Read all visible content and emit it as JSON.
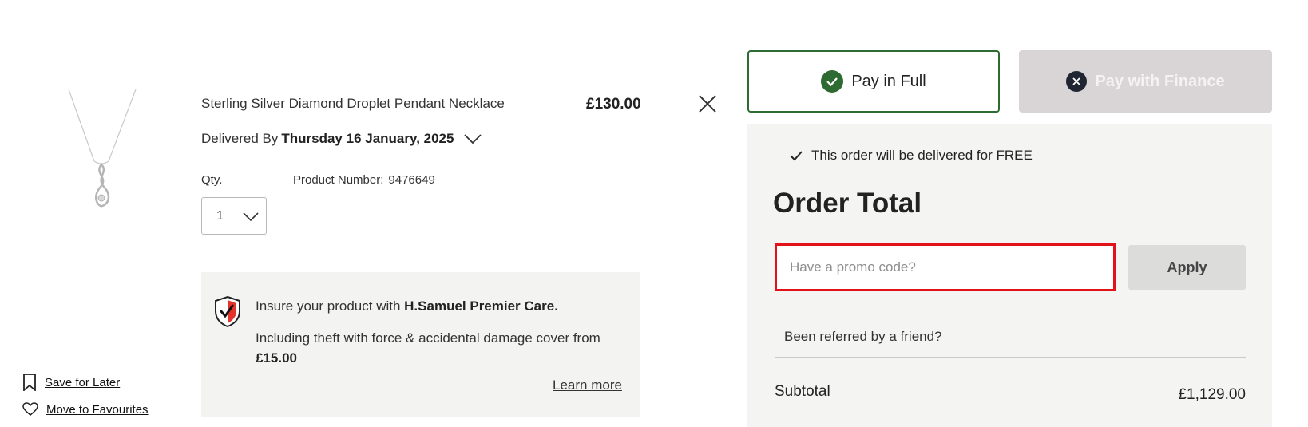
{
  "product": {
    "title": "Sterling Silver Diamond Droplet Pendant Necklace",
    "price": "£130.00",
    "delivery_prefix": "Delivered By",
    "delivery_date": "Thursday 16 January, 2025",
    "qty_label": "Qty.",
    "qty_value": "1",
    "product_number_label": "Product Number:",
    "product_number": "9476649"
  },
  "insurance": {
    "title_prefix": "Insure your product with",
    "title_brand": "H.Samuel Premier Care.",
    "desc_prefix": "Including theft with force & accidental damage cover from",
    "desc_price": "£15.00",
    "learn_more": "Learn more"
  },
  "item_actions": {
    "save_for_later": "Save for Later",
    "move_to_favourites": "Move to Favourites"
  },
  "payment": {
    "pay_in_full": "Pay in Full",
    "pay_with_finance": "Pay with Finance"
  },
  "summary": {
    "free_delivery": "This order will be delivered for FREE",
    "order_total_heading": "Order Total",
    "promo_placeholder": "Have a promo code?",
    "apply_label": "Apply",
    "referred": "Been referred by a friend?",
    "subtotal_label": "Subtotal",
    "subtotal_value": "£1,129.00"
  },
  "colors": {
    "accent_green": "#2e6b32",
    "promo_border_red": "#e3121a",
    "finance_disabled_bg": "#d9d5d6"
  }
}
